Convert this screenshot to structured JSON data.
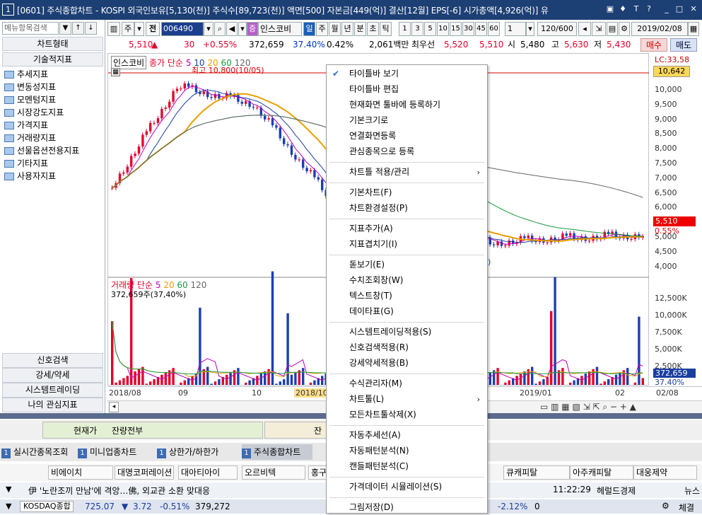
{
  "window": {
    "number": "1",
    "title": "[0601] 주식종합차트 - KOSPI 외국인보유[5,130(천)] 주식수[89,723(천)] 액면[500] 자본금[449(억)] 결산[12월] EPS[-6] 시가총액[4,926(억)] 유"
  },
  "left_panel": {
    "search_placeholder": "메뉴항목검색",
    "header_chart_type": "차트형태",
    "header_indicator": "기술적지표",
    "tree_items": [
      "추세지표",
      "변동성지표",
      "모멘텀지표",
      "시장강도지표",
      "가격지표",
      "거래량지표",
      "선물옵션전용지표",
      "기타지표",
      "사용자지표"
    ],
    "bottom_items": [
      "신호검색",
      "강세/약세",
      "시스템트레이딩",
      "나의 관심지표"
    ]
  },
  "toolbar": {
    "period_unit": "주",
    "prev_label": "전",
    "code": "006490",
    "stock_tag": "증",
    "stock_name": "인스코비",
    "periods": [
      "일",
      "주",
      "월",
      "년",
      "분",
      "초",
      "틱"
    ],
    "numbers": [
      "1",
      "3",
      "5",
      "10",
      "15",
      "30",
      "45",
      "60"
    ],
    "count_value": "1",
    "range": "120/600",
    "date": "2019/02/08"
  },
  "quote": {
    "price": "5,510",
    "change_arrow": "▲",
    "change": "30",
    "change_pct": "+0.55%",
    "volume": "372,659",
    "vol_pct": "37.40%",
    "vol_pct2": "0.42%",
    "amount": "2,061백만",
    "price_label": "최우선",
    "best_bid": "5,520",
    "best_ask": "5,510",
    "open_label": "시",
    "open": "5,480",
    "high_label": "고",
    "high": "5,630",
    "low_label": "저",
    "low": "5,430",
    "buy_label": "매수",
    "sell_label": "매도"
  },
  "chart": {
    "price_legend": {
      "name": "인스코비",
      "series": "종가 단순",
      "ma": [
        "5",
        "10",
        "20",
        "60",
        "120"
      ]
    },
    "high_annotation": "최고 10,800(10/05)",
    "low_annotation": "5)",
    "volume_legend": {
      "name": "거래량 단순",
      "ma": [
        "5",
        "20",
        "60",
        "120"
      ]
    },
    "volume_value": "372,659주(37,40%)",
    "y_labels": [
      "10,000",
      "9,500",
      "9,000",
      "8,500",
      "8,000",
      "7,500",
      "7,000",
      "6,500",
      "6,000",
      "5,500",
      "5,000",
      "4,500",
      "4,000"
    ],
    "y_top_label": "LC:33,58",
    "y_box_top": "10,642",
    "y_current": "5,510",
    "y_current_pct": "0.55%",
    "vol_y_labels": [
      "12,500K",
      "10,000K",
      "7,500K",
      "5,000K",
      "2,500K"
    ],
    "vol_current": "372,659",
    "vol_current_pct": "37.40%",
    "x_labels": [
      "2018/08",
      "09",
      "10",
      "2018/10",
      "2019/01",
      "02",
      "02/08"
    ]
  },
  "context_menu": {
    "items": [
      {
        "label": "타이틀바 보기",
        "checked": true
      },
      {
        "label": "타이틀바 편집"
      },
      {
        "label": "현재화면 툴바에 등록하기"
      },
      {
        "label": "기본크기로"
      },
      {
        "label": "연결화면등록"
      },
      {
        "label": "관심종목으로 등록"
      },
      {
        "label": "차트틀 적용/관리",
        "submenu": true
      },
      {
        "label": "기본차트(F)"
      },
      {
        "label": "차트환경설정(P)"
      },
      {
        "label": "지표추가(A)"
      },
      {
        "label": "지표겹치기(I)"
      },
      {
        "label": "돋보기(E)"
      },
      {
        "label": "수치조회창(W)"
      },
      {
        "label": "텍스트창(T)"
      },
      {
        "label": "데이타표(G)"
      },
      {
        "label": "시스템트레이딩적용(S)"
      },
      {
        "label": "신호검색적용(R)"
      },
      {
        "label": "강세약세적용(B)"
      },
      {
        "label": "수식관리자(M)"
      },
      {
        "label": "차트툴(L)",
        "submenu": true
      },
      {
        "label": "모든차트툴삭제(X)"
      },
      {
        "label": "자동추세선(A)"
      },
      {
        "label": "자동패턴분석(N)"
      },
      {
        "label": "캔들패턴분석(C)"
      },
      {
        "label": "가격데이터 시뮬레이션(S)"
      },
      {
        "label": "그림저장(D)"
      }
    ]
  },
  "lower": {
    "current_price_label": "현재가",
    "balance_label": "잔량전부",
    "partial_label": "잔",
    "tabs": [
      {
        "num": "1",
        "label": "실시간종목조회"
      },
      {
        "num": "1",
        "label": "미니업종차트"
      },
      {
        "num": "1",
        "label": "상한가/하한가"
      },
      {
        "num": "1",
        "label": "주식종합차트"
      }
    ],
    "stocks": [
      "비에이치",
      "대명코퍼레이션",
      "대아티아이",
      "오르비텍",
      "홍구",
      "큐캐피탈",
      "아주캐피탈",
      "대웅제약"
    ],
    "news_text": "伊 '노란조끼 만남'에 격앙…佛, 외교관 소환 맞대응",
    "news_time": "11:22:29",
    "news_source": "헤럴드경제",
    "news_tab": "뉴스",
    "ticker_name": "KOSDAQ종합",
    "ticker_value": "725.07",
    "ticker_arrow": "▼",
    "ticker_change": "3.72",
    "ticker_pct": "-0.51%",
    "ticker_vol": "379,272",
    "ticker_pct2": "-2.12%",
    "ticker_zero": "0",
    "ticker_sign": "체결"
  }
}
